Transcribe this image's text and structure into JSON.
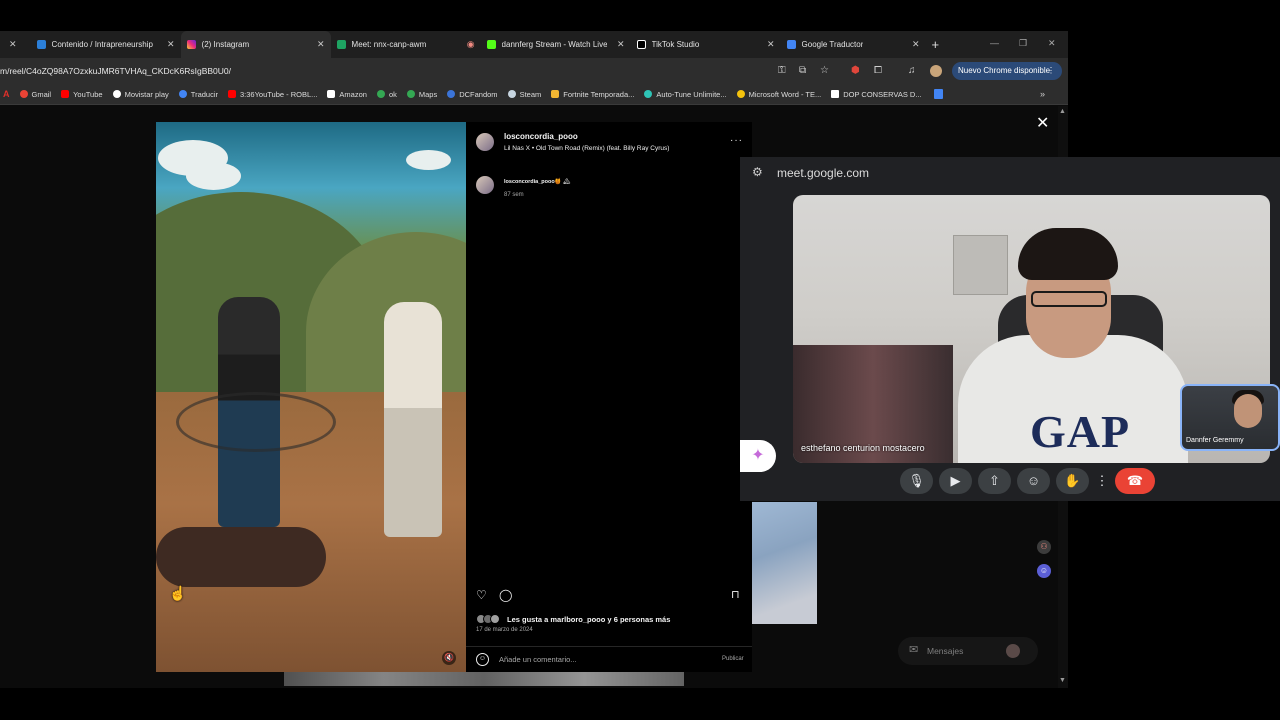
{
  "browser": {
    "tabs": [
      {
        "title": "Contenido / Intrapreneurship",
        "icon": "azure-icon",
        "color": "#2b7fd8"
      },
      {
        "title": "(2) Instagram",
        "icon": "instagram-icon",
        "color": "#e1306c",
        "active": true
      },
      {
        "title": "Meet: nnx-canp-awm",
        "icon": "meet-icon",
        "color": "#1ea362"
      },
      {
        "title": "dannferg Stream - Watch Live",
        "icon": "kick-icon",
        "color": "#53fc18"
      },
      {
        "title": "TikTok Studio",
        "icon": "tiktok-icon",
        "color": "#ffffff"
      },
      {
        "title": "Google Traductor",
        "icon": "translate-icon",
        "color": "#4285f4"
      }
    ],
    "url": "m/reel/C4oZQ98A7OzxkuJMR6TVHAq_CKDcK6RsIgBB0U0/",
    "update_button": "Nuevo Chrome disponible",
    "bookmarks": [
      {
        "label": "Gmail",
        "color": "#ea4335"
      },
      {
        "label": "YouTube",
        "color": "#ff0000"
      },
      {
        "label": "Movistar play",
        "color": "#ffffff"
      },
      {
        "label": "Traducir",
        "color": "#4285f4"
      },
      {
        "label": "3:36YouTube - ROBL...",
        "color": "#ff0000"
      },
      {
        "label": "Amazon",
        "color": "#ffffff"
      },
      {
        "label": "ok",
        "color": "#34a853"
      },
      {
        "label": "Maps",
        "color": "#34a853"
      },
      {
        "label": "DCFandom",
        "color": "#3b74d8"
      },
      {
        "label": "Steam",
        "color": "#c7d5e0"
      },
      {
        "label": "Fortnite Temporada...",
        "color": "#f2b632"
      },
      {
        "label": "Auto-Tune Unlimite...",
        "color": "#2ec4b6"
      },
      {
        "label": "Microsoft Word - TE...",
        "color": "#f4c20d"
      },
      {
        "label": "DOP CONSERVAS D...",
        "color": "#ffffff"
      }
    ]
  },
  "reel": {
    "username": "losconcordia_pooo",
    "song": "Lil Nas X • Old Town Road (Remix) (feat. Billy Ray Cyrus)",
    "comment_username": "losconcordia_pooo",
    "comment_emojis": "🍯 🏔",
    "comment_time": "87 sem",
    "likes_text": "Les gusta a marlboro_pooo y 6 personas más",
    "date": "17 de marzo de 2024",
    "comment_placeholder": "Añade un comentario...",
    "publish_label": "Publicar"
  },
  "meet": {
    "host": "meet.google.com",
    "participant_name": "esthefano centurion mostacero",
    "self_name": "Dannfer Geremmy",
    "shirt_text": "GAP",
    "messages_label": "Mensajes"
  }
}
